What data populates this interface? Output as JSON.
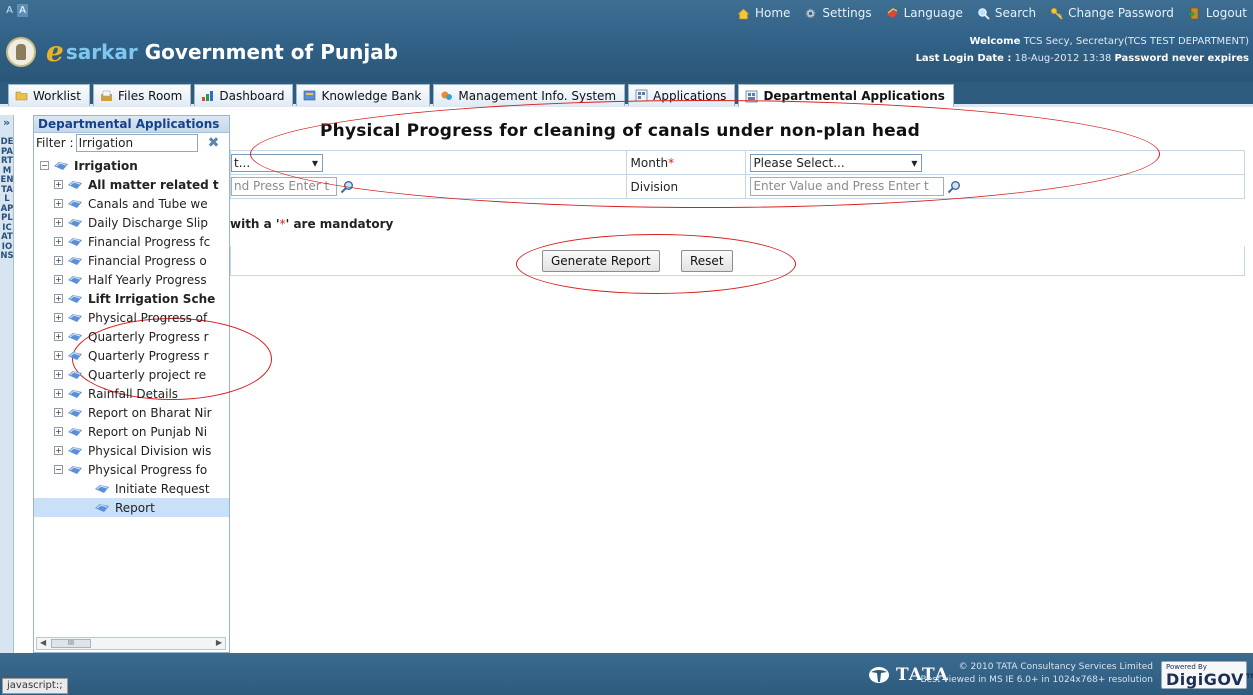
{
  "header": {
    "font_small": "A",
    "font_large": "A",
    "nav": {
      "home": "Home",
      "settings": "Settings",
      "language": "Language",
      "search": "Search",
      "change_password": "Change Password",
      "logout": "Logout"
    },
    "brand_e": "e",
    "brand_sarkar": "sarkar",
    "brand_gov": "Government of Punjab",
    "welcome_label": "Welcome",
    "welcome_user": "TCS Secy, Secretary(TCS TEST DEPARTMENT)",
    "last_login_label": "Last Login Date :",
    "last_login_value": "18-Aug-2012 13:38",
    "password_note": "Password never expires"
  },
  "tabs": [
    {
      "label": "Worklist"
    },
    {
      "label": "Files Room"
    },
    {
      "label": "Dashboard"
    },
    {
      "label": "Knowledge Bank"
    },
    {
      "label": "Management Info. System"
    },
    {
      "label": "Applications"
    },
    {
      "label": "Departmental Applications"
    }
  ],
  "vstrip": {
    "expand": "»",
    "text": "DEPARTMENTAL APPLICATIONS"
  },
  "panel": {
    "title": "Departmental Applications",
    "filter_label": "Filter :",
    "filter_value": "Irrigation",
    "tree": {
      "root": "Irrigation",
      "items": [
        "All matter related t",
        "Canals and Tube we",
        "Daily Discharge Slip",
        "Financial Progress fc",
        "Financial Progress o",
        "Half Yearly Progress",
        "Lift Irrigation Sche",
        "Physical Progress of",
        "Quarterly Progress r",
        "Quarterly Progress r",
        "Quarterly project re",
        "Rainfall Details",
        "Report on Bharat Nir",
        "Report on Punjab Ni",
        "Physical Division wis",
        "Physical Progress fo"
      ],
      "children": [
        "Initiate Request",
        "Report"
      ]
    },
    "scroll_thumb": "III"
  },
  "main": {
    "title": "Physical Progress for cleaning of canals under non-plan head",
    "row1_left_select": "t...",
    "month_label": "Month",
    "month_select": "Please Select...",
    "row2_left_input_placeholder": "nd Press Enter t",
    "division_label": "Division",
    "division_placeholder": "Enter Value and Press Enter t",
    "mandatory_prefix": "with a '",
    "mandatory_star": "*",
    "mandatory_suffix": "' are mandatory",
    "required_star": "*",
    "generate_button": "Generate Report",
    "reset_button": "Reset"
  },
  "footer": {
    "status_text": "javascript:;",
    "tata": "TATA",
    "copyright": "© 2010 TATA Consultancy Services Limited",
    "best_viewed": "Best viewed in MS IE 6.0+ in 1024x768+ resolution",
    "powered_by": "Powered By",
    "digigov": "DigiGOV™"
  }
}
